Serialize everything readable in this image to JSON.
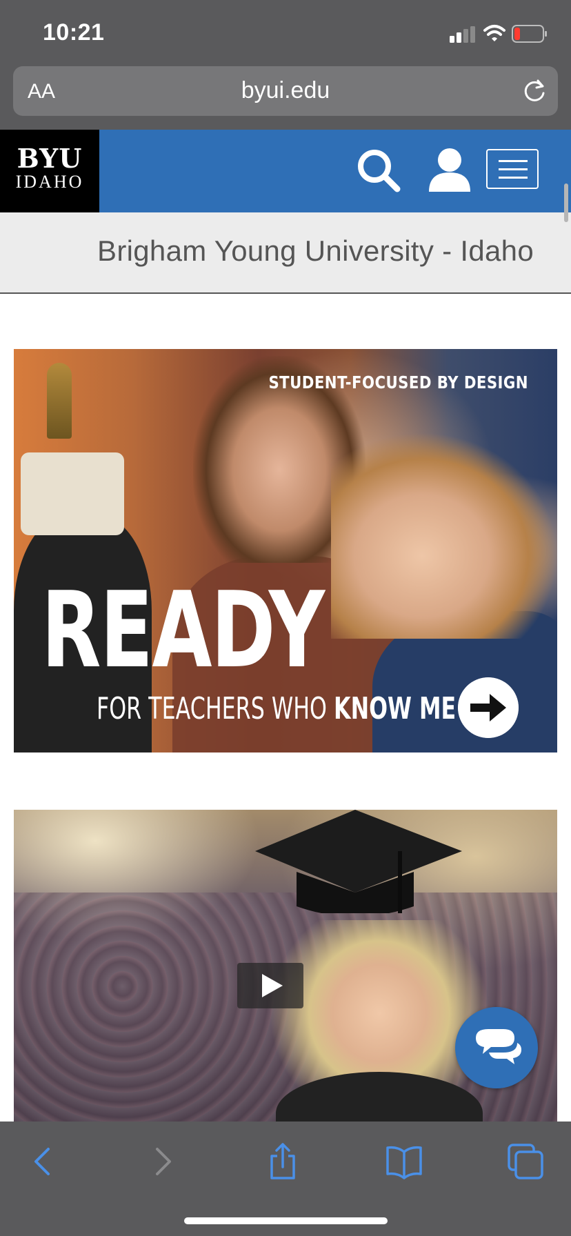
{
  "status_bar": {
    "time": "10:21",
    "signal_icon": "cellular-signal-icon",
    "wifi_icon": "wifi-icon",
    "battery_icon": "battery-low-icon"
  },
  "browser": {
    "text_size_label": "AA",
    "url": "byui.edu",
    "reload_icon": "reload-icon"
  },
  "site_header": {
    "logo_line1": "BYU",
    "logo_line2": "IDAHO",
    "search_icon": "search-icon",
    "account_icon": "user-icon",
    "menu_icon": "hamburger-menu-icon",
    "colors": {
      "header_blue": "#2f6fb6",
      "logo_black": "#000000"
    }
  },
  "title_band": {
    "title": "Brigham Young University - Idaho"
  },
  "banners": [
    {
      "tagline": "STUDENT-FOCUSED BY DESIGN",
      "headline": "READY",
      "subline_regular": "FOR TEACHERS WHO ",
      "subline_bold": "KNOW ME",
      "arrow_icon": "arrow-right-circle-icon"
    },
    {
      "play_icon": "play-icon"
    }
  ],
  "chat": {
    "icon": "chat-bubbles-icon"
  },
  "toolbar": {
    "back_icon": "back-chevron-icon",
    "forward_icon": "forward-chevron-icon",
    "share_icon": "share-icon",
    "bookmarks_icon": "book-icon",
    "tabs_icon": "tabs-icon"
  }
}
